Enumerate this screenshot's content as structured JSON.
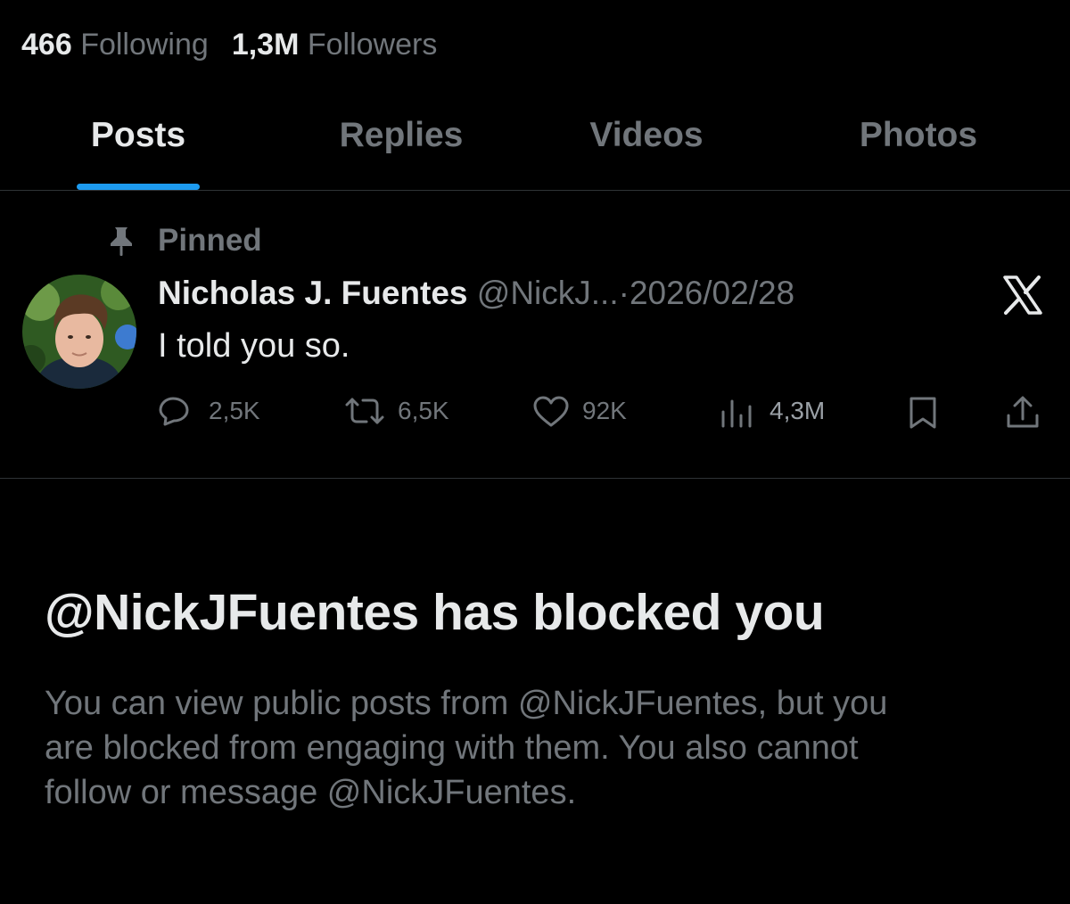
{
  "profile_stats": {
    "following_count": "466",
    "following_label": "Following",
    "followers_count": "1,3M",
    "followers_label": "Followers"
  },
  "tabs": [
    {
      "label": "Posts",
      "active": true
    },
    {
      "label": "Replies",
      "active": false
    },
    {
      "label": "Videos",
      "active": false
    },
    {
      "label": "Photos",
      "active": false
    }
  ],
  "pinned_post": {
    "pinned_label": "Pinned",
    "pin_icon": "pin-icon",
    "author_name": "Nicholas J. Fuentes",
    "author_handle": "@NickJ...",
    "separator": "·",
    "date": "2026/02/28",
    "source_icon": "x-logo-icon",
    "text": "I told you so.",
    "actions": {
      "replies": "2,5K",
      "reposts": "6,5K",
      "likes": "92K",
      "views": "4,3M"
    }
  },
  "blocked_notice": {
    "title": "@NickJFuentes has blocked you",
    "description_lines": [
      "You can view public posts from @NickJFuentes, but you",
      "are blocked from engaging with them. You also cannot",
      "follow or message @NickJFuentes."
    ]
  },
  "colors": {
    "background": "#000000",
    "primary_text": "#e7e9ea",
    "secondary_text": "#71767b",
    "accent": "#1d9bf0",
    "divider": "#2f3336"
  }
}
